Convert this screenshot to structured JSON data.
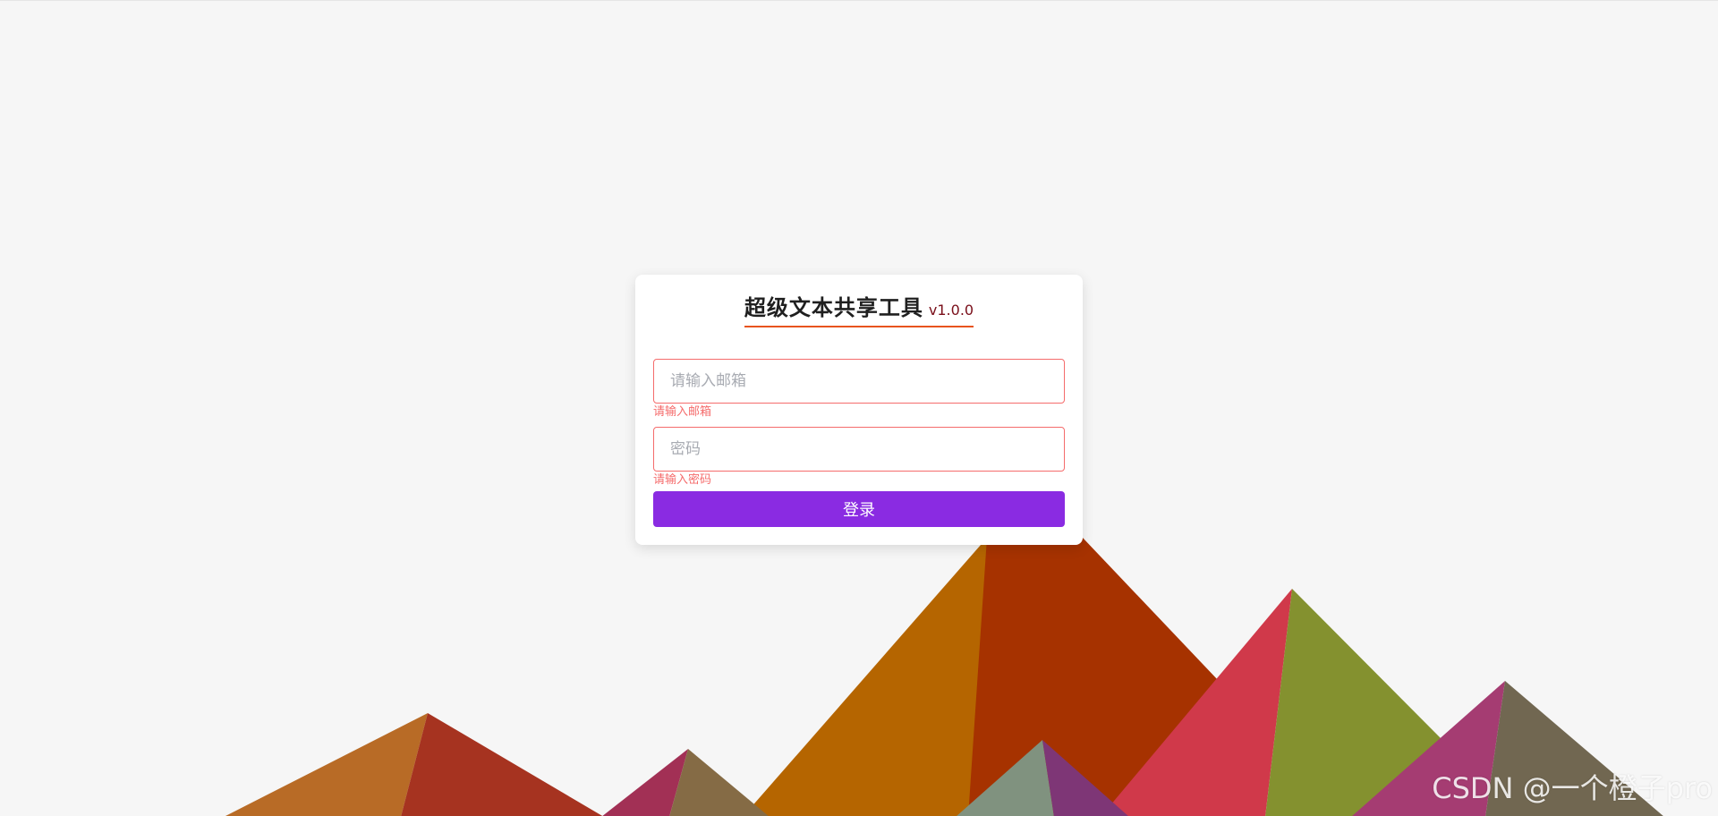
{
  "app": {
    "title": "超级文本共享工具",
    "version": "v1.0.0"
  },
  "form": {
    "email": {
      "value": "",
      "placeholder": "请输入邮箱",
      "error": "请输入邮箱"
    },
    "password": {
      "value": "",
      "placeholder": "密码",
      "error": "请输入密码"
    },
    "submit_label": "登录"
  },
  "watermark": "CSDN @一个橙子pro",
  "colors": {
    "background": "#f6f6f6",
    "accent": "#8a2be2",
    "error": "#f56c6c",
    "title_underline": "#e8541e"
  }
}
